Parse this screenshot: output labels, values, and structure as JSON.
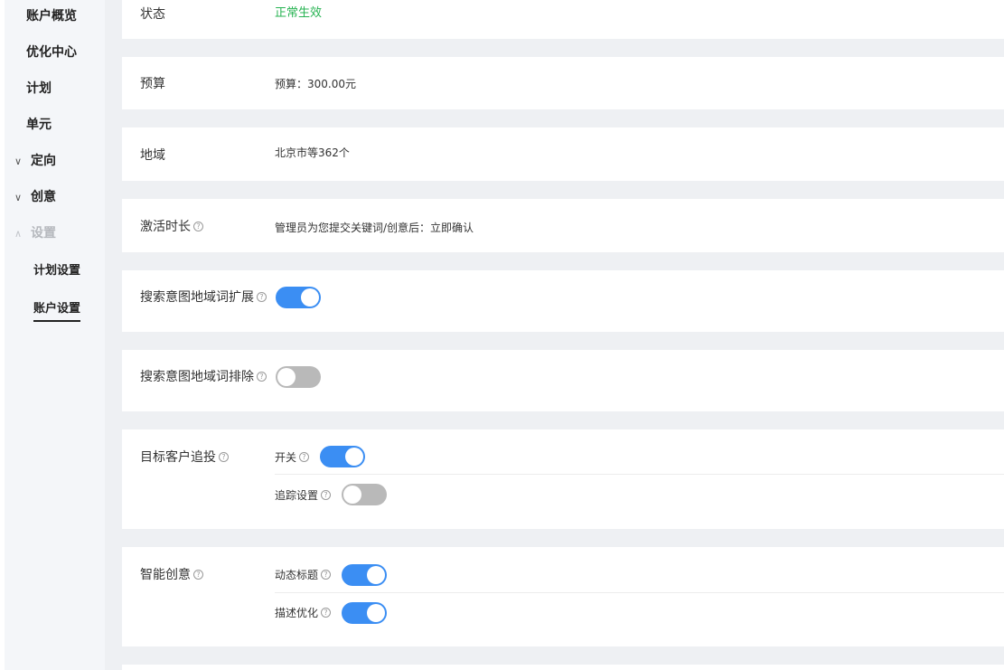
{
  "sidebar": {
    "items": [
      {
        "label": "账户概览"
      },
      {
        "label": "优化中心"
      },
      {
        "label": "计划"
      },
      {
        "label": "单元"
      },
      {
        "label": "定向",
        "chevron": "chevron-down-icon"
      },
      {
        "label": "创意",
        "chevron": "chevron-down-icon"
      },
      {
        "label": "设置",
        "chevron": "chevron-up-icon"
      }
    ],
    "sub_items": [
      {
        "label": "计划设置"
      },
      {
        "label": "账户设置"
      }
    ]
  },
  "settings": {
    "status": {
      "label": "状态",
      "value": "正常生效"
    },
    "budget": {
      "label": "预算",
      "value": "预算：300.00元"
    },
    "region": {
      "label": "地域",
      "value": "北京市等362个"
    },
    "activation": {
      "label": "激活时长",
      "value": "管理员为您提交关键词/创意后：立即确认"
    },
    "region_expand": {
      "label": "搜索意图地域词扩展",
      "on": true
    },
    "region_exclude": {
      "label": "搜索意图地域词排除",
      "on": false
    },
    "retarget": {
      "label": "目标客户追投",
      "switch_label": "开关",
      "switch_on": true,
      "tracking_label": "追踪设置",
      "tracking_on": false
    },
    "smart_creative": {
      "label": "智能创意",
      "dynamic_title_label": "动态标题",
      "dynamic_title_on": true,
      "desc_opt_label": "描述优化",
      "desc_opt_on": true
    }
  },
  "icons": {
    "help": "?",
    "chevron_down": "∨",
    "chevron_up": "∧"
  },
  "colors": {
    "accent": "#3b8ef3",
    "success": "#27b352",
    "switch_off": "#b9b9b9"
  }
}
